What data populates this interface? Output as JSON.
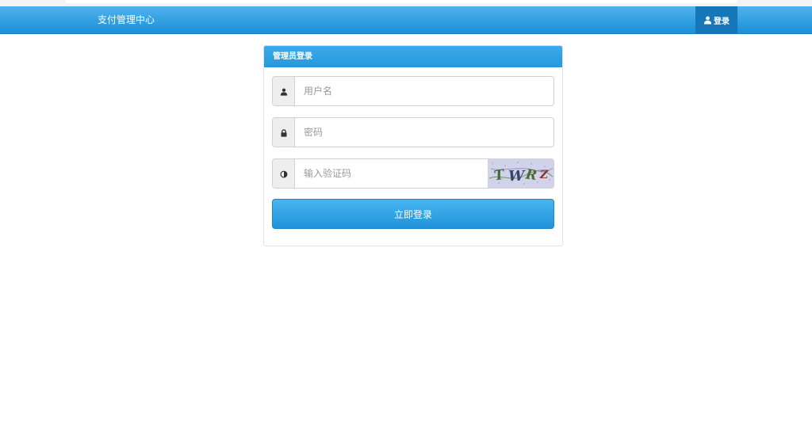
{
  "navbar": {
    "brand": "支付管理中心",
    "login_label": "登录",
    "login_icon": "user-icon"
  },
  "login_panel": {
    "title": "管理员登录",
    "username": {
      "placeholder": "用户名",
      "value": "",
      "icon": "user-icon"
    },
    "password": {
      "placeholder": "密码",
      "value": "",
      "icon": "lock-icon"
    },
    "captcha": {
      "placeholder": "输入验证码",
      "value": "",
      "icon": "half-circle-icon",
      "image_text": "TWRZ"
    },
    "submit_label": "立即登录"
  },
  "colors": {
    "nav_gradient_top": "#4fb3ec",
    "nav_gradient_bottom": "#1b8fd8",
    "nav_login_bg": "#1577b8",
    "panel_heading": "#2399dd",
    "button": "#1f93dc"
  }
}
